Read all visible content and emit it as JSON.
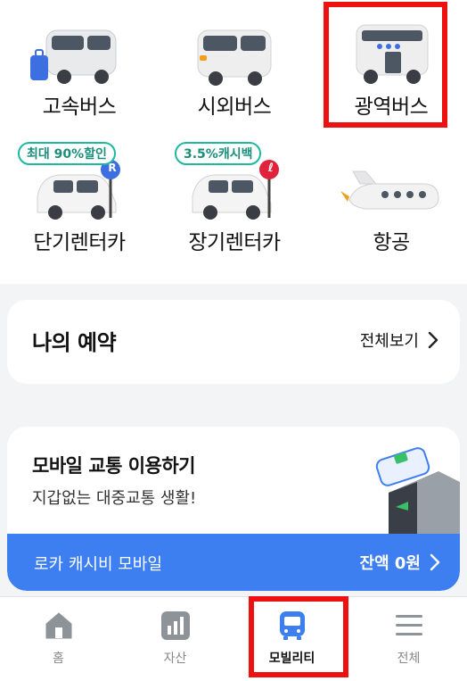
{
  "services": [
    {
      "label": "고속버스",
      "icon": "express-bus-icon"
    },
    {
      "label": "시외버스",
      "icon": "intercity-bus-icon"
    },
    {
      "label": "광역버스",
      "icon": "metropolitan-bus-icon"
    },
    {
      "label": "단기렌터카",
      "icon": "short-term-rental-car-icon",
      "promo": "최대 90%할인",
      "marker": "R"
    },
    {
      "label": "장기렌터카",
      "icon": "long-term-rental-car-icon",
      "promo": "3.5%캐시백",
      "marker": "ℓ"
    },
    {
      "label": "항공",
      "icon": "airplane-icon"
    }
  ],
  "reservations": {
    "title": "나의 예약",
    "link": "전체보기"
  },
  "mobile_transit": {
    "title": "모바일 교통 이용하기",
    "subtitle": "지갑없는 대중교통 생활!",
    "card_name": "로카 캐시비 모바일",
    "balance": "잔액 0원"
  },
  "nav": [
    {
      "label": "홈",
      "icon": "home-icon"
    },
    {
      "label": "자산",
      "icon": "asset-chart-icon"
    },
    {
      "label": "모빌리티",
      "icon": "bus-icon",
      "active": true
    },
    {
      "label": "전체",
      "icon": "menu-icon"
    }
  ],
  "colors": {
    "accent": "#3d7ef0",
    "highlight": "#ee1111",
    "promo": "#1db8a0"
  }
}
